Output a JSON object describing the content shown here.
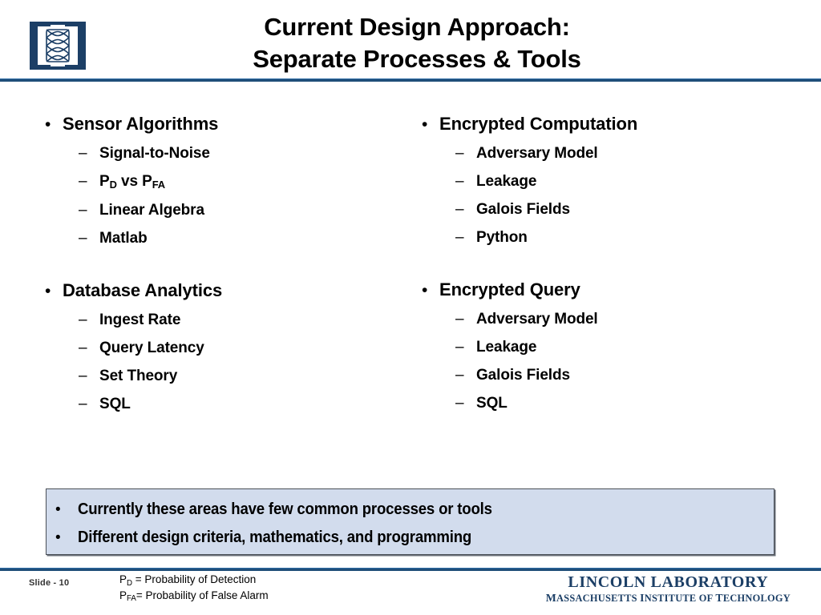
{
  "header": {
    "logo_icon": "lincoln-laboratory-lattice-logo",
    "title_line1": "Current Design Approach:",
    "title_line2": "Separate Processes & Tools",
    "rule_color": "#1f4e79"
  },
  "content": {
    "bullet_glyph": "•",
    "dash_glyph": "–",
    "left_column": [
      {
        "topic": "Sensor Algorithms",
        "items": [
          {
            "text": "Signal-to-Noise"
          },
          {
            "text": "P",
            "sub1": "D",
            "mid": " vs P",
            "sub2": "FA"
          },
          {
            "text": "Linear Algebra"
          },
          {
            "text": "Matlab"
          }
        ]
      },
      {
        "topic": "Database Analytics",
        "items": [
          {
            "text": "Ingest Rate"
          },
          {
            "text": "Query Latency"
          },
          {
            "text": "Set Theory"
          },
          {
            "text": "SQL"
          }
        ]
      }
    ],
    "right_column": [
      {
        "topic": "Encrypted Computation",
        "items": [
          {
            "text": "Adversary Model"
          },
          {
            "text": "Leakage"
          },
          {
            "text": "Galois Fields"
          },
          {
            "text": "Python"
          }
        ]
      },
      {
        "topic": "Encrypted Query",
        "items": [
          {
            "text": "Adversary Model"
          },
          {
            "text": "Leakage"
          },
          {
            "text": "Galois Fields"
          },
          {
            "text": "SQL"
          }
        ]
      }
    ]
  },
  "callout": {
    "bullet_glyph": "•",
    "line1": "Currently these areas have few common processes or tools",
    "line2": "Different design criteria, mathematics, and programming",
    "fill_color": "#d2dced",
    "border_color": "#4a4f57"
  },
  "footer": {
    "slide_number": "Slide - 10",
    "legend": {
      "pd_symbol": "P",
      "pd_sub": "D",
      "pd_text": " = Probability of Detection",
      "pfa_symbol": "P",
      "pfa_sub": "FA",
      "pfa_text": "= Probability of False Alarm"
    },
    "wordmark_line1": "LINCOLN LABORATORY",
    "wordmark_line2_caps": "M",
    "wordmark_line2": "ASSACHUSETTS ",
    "wordmark_line2_caps2": "I",
    "wordmark_line2b": "NSTITUTE OF ",
    "wordmark_line2_caps3": "T",
    "wordmark_line2c": "ECHNOLOGY",
    "wordmark_color": "#1c3f66"
  }
}
